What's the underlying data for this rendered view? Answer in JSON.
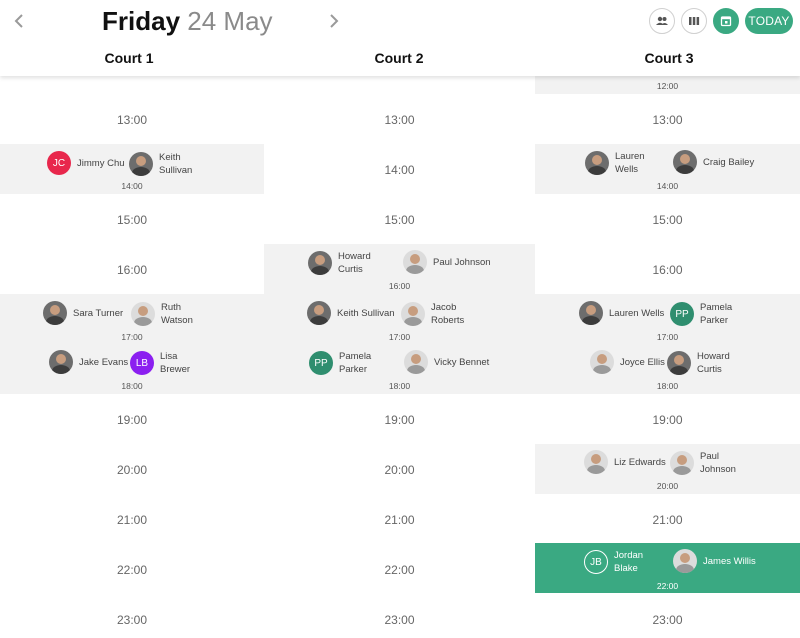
{
  "header": {
    "day": "Friday",
    "date": "24 May",
    "today_label": "TODAY",
    "icons": [
      "chevron-left-icon",
      "chevron-right-icon",
      "people-icon",
      "columns-icon",
      "calendar-icon"
    ]
  },
  "courts": [
    "Court 1",
    "Court 2",
    "Court 3"
  ],
  "hours": [
    "12:00",
    "13:00",
    "14:00",
    "15:00",
    "16:00",
    "17:00",
    "18:00",
    "19:00",
    "20:00",
    "21:00",
    "22:00",
    "23:00"
  ],
  "colors": {
    "accent": "#3aa982",
    "booked_bg": "#f2f2f2",
    "avatar_red": "#e8274c",
    "avatar_teal": "#2f8e6f",
    "avatar_purple": "#8b1ff0"
  },
  "bookings": {
    "c1_14": {
      "time": "14:00",
      "p1": "Jimmy Chu",
      "p1_initials": "JC",
      "p2_line1": "Keith",
      "p2_line2": "Sullivan"
    },
    "c1_17": {
      "time": "17:00",
      "p1": "Sara Turner",
      "p2_line1": "Ruth",
      "p2_line2": "Watson"
    },
    "c1_18": {
      "time": "18:00",
      "p1": "Jake Evans",
      "p2_initials": "LB",
      "p2_line1": "Lisa",
      "p2_line2": "Brewer"
    },
    "c2_16": {
      "time": "16:00",
      "p1_line1": "Howard",
      "p1_line2": "Curtis",
      "p2": "Paul Johnson"
    },
    "c2_17": {
      "time": "17:00",
      "p1": "Keith Sullivan",
      "p2_line1": "Jacob",
      "p2_line2": "Roberts"
    },
    "c2_18": {
      "time": "18:00",
      "p1_initials": "PP",
      "p1_line1": "Pamela",
      "p1_line2": "Parker",
      "p2": "Vicky Bennet"
    },
    "c3_14": {
      "time": "14:00",
      "p1_line1": "Lauren",
      "p1_line2": "Wells",
      "p2": "Craig Bailey"
    },
    "c3_17": {
      "time": "17:00",
      "p1": "Lauren Wells",
      "p2_initials": "PP",
      "p2_line1": "Pamela",
      "p2_line2": "Parker"
    },
    "c3_18": {
      "time": "18:00",
      "p1": "Joyce Ellis",
      "p2_line1": "Howard",
      "p2_line2": "Curtis"
    },
    "c3_20": {
      "time": "20:00",
      "p1": "Liz Edwards",
      "p2_line1": "Paul",
      "p2_line2": "Johnson"
    },
    "c3_22": {
      "time": "22:00",
      "p1_initials": "JB",
      "p1_line1": "Jordan",
      "p1_line2": "Blake",
      "p2": "James Willis"
    }
  }
}
